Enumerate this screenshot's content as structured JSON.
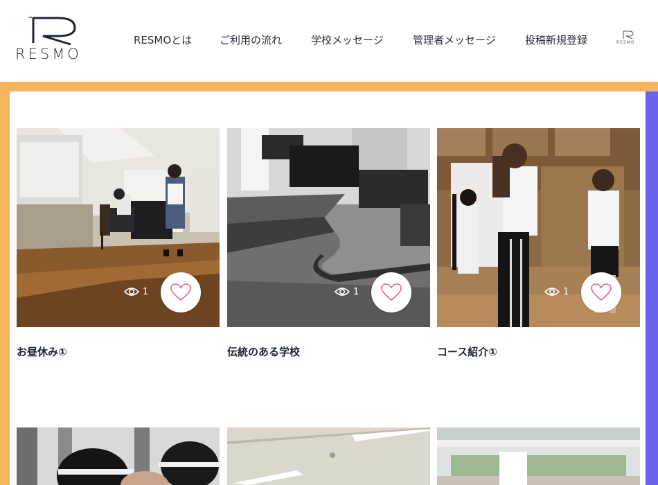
{
  "header": {
    "logo_text": "RESMO",
    "mini_logo_text": "RESMO",
    "nav": [
      {
        "label": "RESMOとは"
      },
      {
        "label": "ご利用の流れ"
      },
      {
        "label": "学校メッセージ"
      },
      {
        "label": "管理者メッセージ"
      },
      {
        "label": "投稿新規登録"
      }
    ]
  },
  "colors": {
    "frame_orange": "#f7b35e",
    "frame_purple": "#6b63ee",
    "heart_pink": "#e0608a",
    "text_dark": "#1f2433"
  },
  "posts": [
    {
      "title": "お昼休み①",
      "views": "1"
    },
    {
      "title": "伝統のある学校",
      "views": "1"
    },
    {
      "title": "コース紹介①",
      "views": "1"
    }
  ],
  "icons": {
    "view": "eye-icon",
    "like": "heart-outline-icon"
  }
}
